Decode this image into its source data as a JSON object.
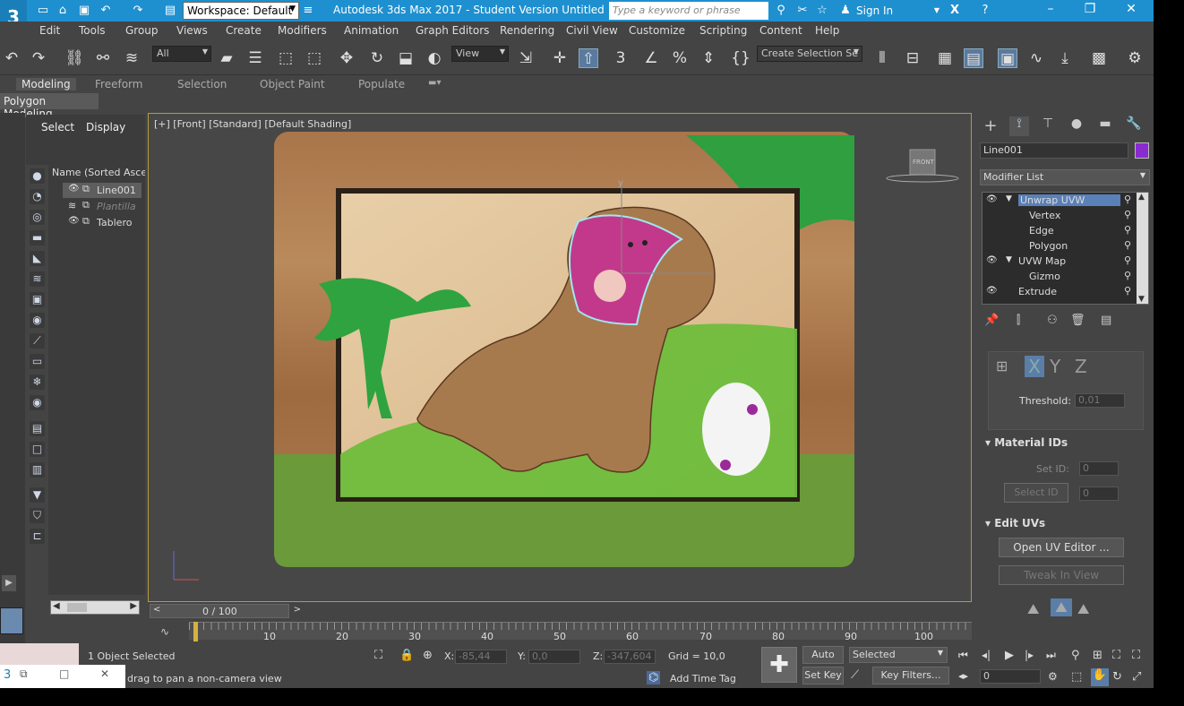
{
  "title": {
    "workspace": "Workspace: Default",
    "window": "Autodesk 3ds Max 2017 - Student Version    Untitled",
    "search_placeholder": "Type a keyword or phrase",
    "signin": "Sign In"
  },
  "menu": [
    "Edit",
    "Tools",
    "Group",
    "Views",
    "Create",
    "Modifiers",
    "Animation",
    "Graph Editors",
    "Rendering",
    "Civil View",
    "Customize",
    "Scripting",
    "Content",
    "Help"
  ],
  "toolbar": {
    "filter": "All",
    "refcoord": "View",
    "selection_set": "Create Selection Se"
  },
  "ribbon": {
    "tabs": [
      "Modeling",
      "Freeform",
      "Selection",
      "Object Paint",
      "Populate"
    ],
    "sub": "Polygon Modeling"
  },
  "scene_explorer": {
    "tabs": [
      "Select",
      "Display"
    ],
    "column": "Name (Sorted Ascen",
    "items": [
      "Line001",
      "Plantilla",
      "Tablero"
    ]
  },
  "viewport": {
    "label": "[+] [Front] [Standard] [Default Shading]",
    "viewcube": "FRONT"
  },
  "command_panel": {
    "object_name": "Line001",
    "modifier_list": "Modifier List",
    "stack": [
      "Unwrap UVW",
      "Vertex",
      "Edge",
      "Polygon",
      "UVW Map",
      "Gizmo",
      "Extrude"
    ],
    "threshold_label": "Threshold:",
    "threshold_value": "0,01",
    "xyz": [
      "X",
      "Y",
      "Z"
    ],
    "material_ids": "Material IDs",
    "set_id": "Set ID:",
    "set_id_value": "0",
    "select_id": "Select ID",
    "select_id_value": "0",
    "edit_uvs": "Edit UVs",
    "open_uv_editor": "Open UV Editor ...",
    "tweak_in_view": "Tweak In View"
  },
  "timeline": {
    "frame": "0 / 100",
    "ticks": [
      "10",
      "20",
      "30",
      "40",
      "50",
      "60",
      "70",
      "80",
      "90",
      "100"
    ]
  },
  "status": {
    "selected": "1 Object Selected",
    "hint": "drag to pan a non-camera view",
    "x_label": "X:",
    "x": "-85,44",
    "y_label": "Y:",
    "y": "0,0",
    "z_label": "Z:",
    "z": "-347,604",
    "grid": "Grid = 10,0",
    "add_time_tag": "Add Time Tag",
    "auto_key": "Auto Key",
    "set_key": "Set Key",
    "selected_combo": "Selected",
    "key_filters": "Key Filters...",
    "frame_field": "0"
  },
  "colors": {
    "titlebar": "#1e90d0",
    "object_color": "#8a2bd0",
    "viewport_border": "#b79a3a"
  }
}
